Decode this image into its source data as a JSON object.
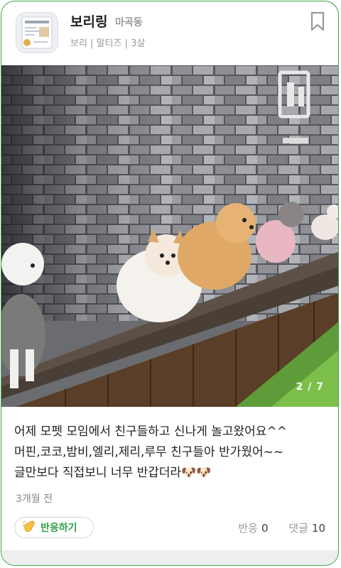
{
  "header": {
    "name": "보리링",
    "region": "마곡동",
    "meta": "보리 | 말티즈 | 3살"
  },
  "photo": {
    "counter": "2 / 7"
  },
  "post": {
    "text": "어제 모펫 모임에서 친구들하고 신나게 놀고왔어요^^\n머핀,코코,밤비,엘리,제리,루무 친구들아 반가웠어~~\n글만보다 직접보니 너무 반갑더라🐶🐶",
    "time": "3개월 전"
  },
  "actions": {
    "react_label": "반응하기",
    "reaction_label": "반응",
    "reaction_count": "0",
    "comment_label": "댓글",
    "comment_count": "10"
  },
  "colors": {
    "accent": "#2f9e44",
    "border": "#3aa64a"
  },
  "icons": [
    "bookmark-icon",
    "wave-hand-icon"
  ]
}
